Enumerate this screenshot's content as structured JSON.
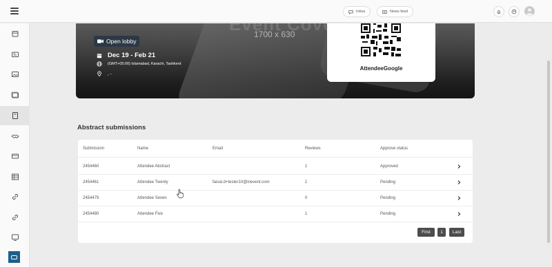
{
  "topbar": {
    "inbox_label": "Inbox",
    "newsfeed_label": "News feed"
  },
  "sidebar": {
    "items": [
      {
        "icon": "calendar-icon"
      },
      {
        "icon": "id-card-icon"
      },
      {
        "icon": "image-icon"
      },
      {
        "icon": "gallery-icon"
      },
      {
        "icon": "book-icon",
        "active": true
      },
      {
        "icon": "handshake-icon"
      },
      {
        "icon": "ticket-icon"
      },
      {
        "icon": "table-icon"
      },
      {
        "icon": "link-icon"
      },
      {
        "icon": "link-alt-icon"
      },
      {
        "icon": "monitor-icon"
      }
    ]
  },
  "banner": {
    "big_text": "Event Cover",
    "dimensions": "1700 x 630",
    "open_lobby_label": "Open lobby",
    "date": "Dec 19 - Feb 21",
    "timezone": "(GMT+05:00) Islamabad, Karachi, Tashkent",
    "location": ", -"
  },
  "qr_card": {
    "name": "AttendeeGoogle"
  },
  "abstracts": {
    "title": "Abstract submissions",
    "headers": {
      "submission": "Submission",
      "name": "Name",
      "email": "Email",
      "reviews": "Reviews",
      "status": "Approve status"
    },
    "rows": [
      {
        "submission": "2454460",
        "name": "Attendee Abstract",
        "email": "",
        "reviews": "1",
        "status": "Approved"
      },
      {
        "submission": "2454461",
        "name": "Attendee Twenty",
        "email": "faisal.d+tester10@inevent.com",
        "reviews": "1",
        "status": "Pending"
      },
      {
        "submission": "2454479",
        "name": "Attendee Seven",
        "email": "",
        "reviews": "0",
        "status": "Pending"
      },
      {
        "submission": "2454480",
        "name": "Attendee Five",
        "email": "",
        "reviews": "1",
        "status": "Pending"
      }
    ],
    "pager": {
      "first": "First",
      "page": "1",
      "last": "Last"
    }
  },
  "colors": {
    "accent_dark": "#2c3845",
    "pager_bg": "#4d4d4d",
    "page_bg": "#ececec"
  }
}
